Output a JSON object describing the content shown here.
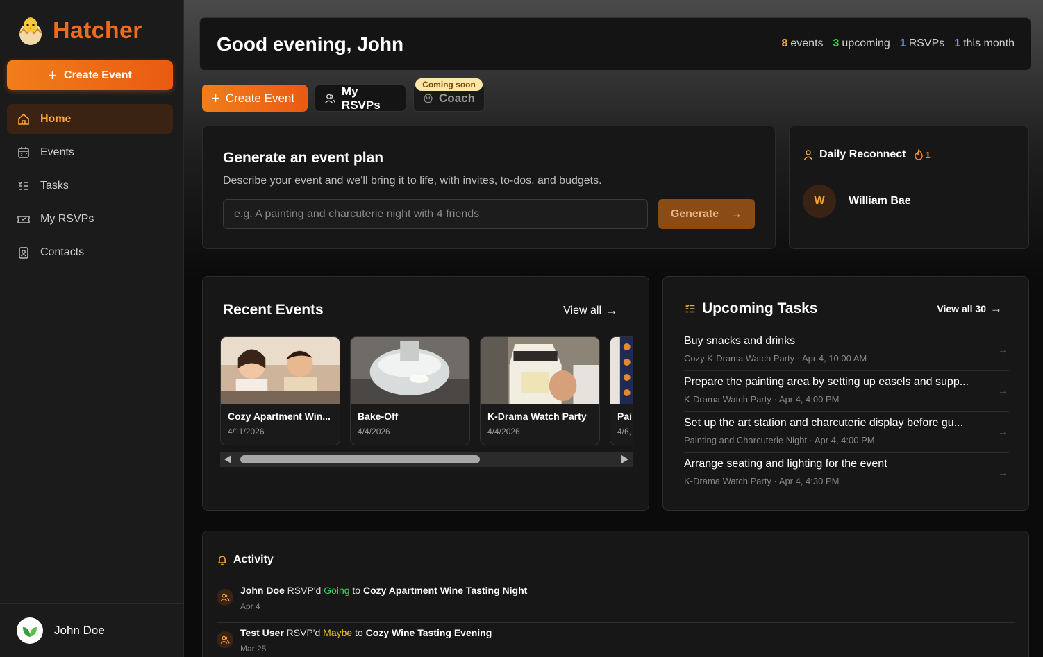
{
  "brand": {
    "name": "Hatcher"
  },
  "sidebar": {
    "create_label": "Create Event",
    "items": [
      {
        "label": "Home",
        "icon": "home-icon"
      },
      {
        "label": "Events",
        "icon": "calendar-icon"
      },
      {
        "label": "Tasks",
        "icon": "list-icon"
      },
      {
        "label": "My RSVPs",
        "icon": "ticket-icon"
      },
      {
        "label": "Contacts",
        "icon": "contact-icon"
      }
    ],
    "user": {
      "name": "John Doe"
    }
  },
  "header": {
    "greeting": "Good evening, John",
    "stats": [
      {
        "count": "8",
        "label": "events",
        "color": "#f7a537"
      },
      {
        "count": "3",
        "label": "upcoming",
        "color": "#3fd25a"
      },
      {
        "count": "1",
        "label": "RSVPs",
        "color": "#5aa7ff"
      },
      {
        "count": "1",
        "label": "this month",
        "color": "#a67bff"
      }
    ]
  },
  "quick_actions": {
    "create_label": "Create Event",
    "rsvp_label": "My RSVPs",
    "coach_label": "Coach",
    "coming_soon": "Coming soon"
  },
  "plan": {
    "title": "Generate an event plan",
    "description": "Describe your event and we'll bring it to life, with invites, to-dos, and budgets.",
    "placeholder": "e.g. A painting and charcuterie night with 4 friends",
    "button": "Generate"
  },
  "reconnect": {
    "title": "Daily Reconnect",
    "streak": "1",
    "person_initial": "W",
    "person_name": "William Bae"
  },
  "recent": {
    "title": "Recent Events",
    "view_all": "View all",
    "events": [
      {
        "name": "Cozy Apartment Win...",
        "date": "4/11/2026"
      },
      {
        "name": "Bake-Off",
        "date": "4/4/2026"
      },
      {
        "name": "K-Drama Watch Party",
        "date": "4/4/2026"
      },
      {
        "name": "Pai",
        "date": "4/6,"
      }
    ]
  },
  "tasks": {
    "title": "Upcoming Tasks",
    "view_all": "View all 30",
    "items": [
      {
        "title": "Buy snacks and drinks",
        "sub": "Cozy K-Drama Watch Party · Apr 4, 10:00 AM"
      },
      {
        "title": "Prepare the painting area by setting up easels and supp...",
        "sub": "K-Drama Watch Party · Apr 4, 4:00 PM"
      },
      {
        "title": "Set up the art station and charcuterie display before gu...",
        "sub": "Painting and Charcuterie Night · Apr 4, 4:00 PM"
      },
      {
        "title": "Arrange seating and lighting for the event",
        "sub": "K-Drama Watch Party · Apr 4, 4:30 PM"
      }
    ]
  },
  "activity": {
    "title": "Activity",
    "items": [
      {
        "user": "John Doe",
        "verb": "RSVP'd",
        "status": "Going",
        "prep": "to",
        "event": "Cozy Apartment Wine Tasting Night",
        "date": "Apr 4"
      },
      {
        "user": "Test User",
        "verb": "RSVP'd",
        "status": "Maybe",
        "prep": "to",
        "event": "Cozy Wine Tasting Evening",
        "date": "Mar 25"
      }
    ]
  }
}
